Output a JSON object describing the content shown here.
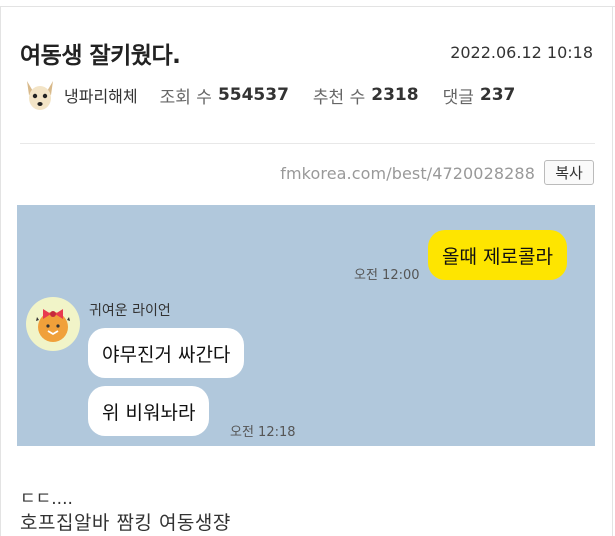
{
  "post": {
    "title": "여동생 잘키웠다.",
    "date": "2022.06.12 10:18",
    "author": "냉파리해체",
    "stats": [
      {
        "label": "조회 수",
        "value": "554537"
      },
      {
        "label": "추천 수",
        "value": "2318"
      },
      {
        "label": "댓글",
        "value": "237"
      }
    ],
    "url": "fmkorea.com/best/4720028288",
    "copy_label": "복사"
  },
  "chat": {
    "messages": [
      {
        "from": "me",
        "text": "올때 제로콜라",
        "time": "오전 12:00"
      },
      {
        "from": "other",
        "sender": "귀여운 라이언",
        "text": "야무진거 싸간다"
      },
      {
        "from": "other",
        "text": "위 비워놔라",
        "time": "오전 12:18"
      }
    ]
  },
  "body": {
    "lines": [
      "ㄷㄷ....",
      "호프집알바 짬킹 여동생쟝"
    ]
  },
  "colors": {
    "chat_background": "#b1c8dc",
    "my_bubble": "#fee500",
    "other_bubble": "#ffffff"
  }
}
